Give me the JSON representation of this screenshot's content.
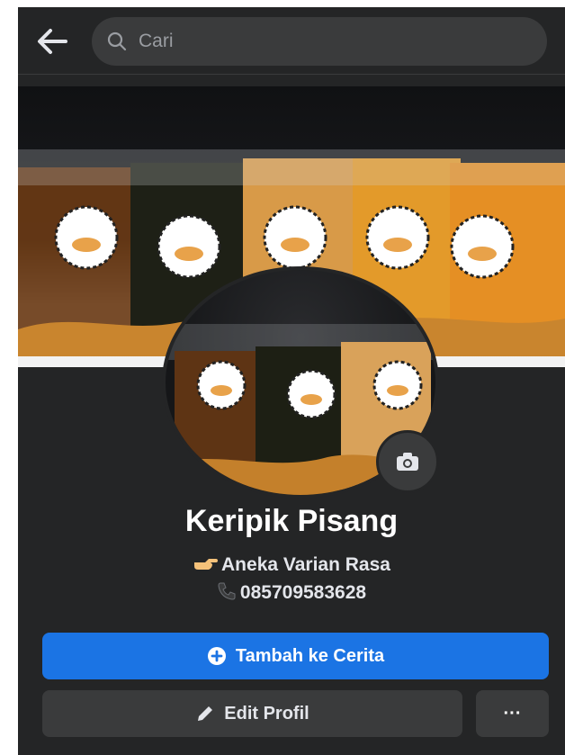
{
  "search": {
    "placeholder": "Cari"
  },
  "profile": {
    "name": "Keripik Pisang",
    "bio_line1": "Aneka Varian Rasa",
    "bio_line2": "085709583628"
  },
  "buttons": {
    "add_story": "Tambah ke Cerita",
    "edit_profile": "Edit Profil",
    "more": "···"
  },
  "colors": {
    "background": "#242526",
    "primary_button": "#1b74e4",
    "secondary_button": "#3a3b3c",
    "text": "#ffffff"
  },
  "icons": {
    "back": "arrow-left-icon",
    "search": "search-icon",
    "camera": "camera-icon",
    "add": "plus-circle-icon",
    "edit": "pencil-icon",
    "bio_line1": "pointing-hand-icon",
    "bio_line2": "phone-icon"
  }
}
